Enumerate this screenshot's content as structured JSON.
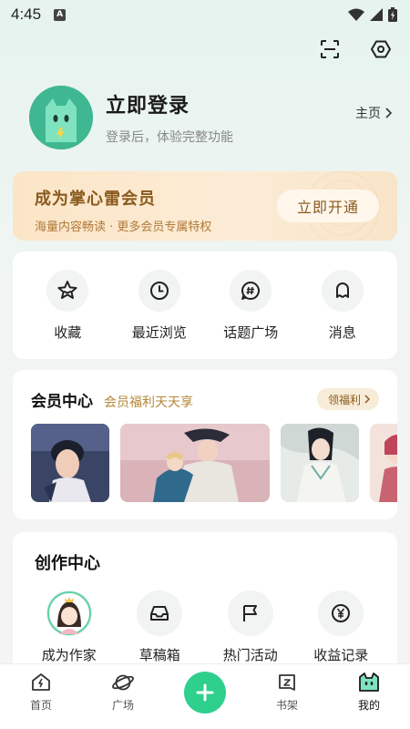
{
  "status": {
    "time": "4:45",
    "notif": "A"
  },
  "profile": {
    "title": "立即登录",
    "subtitle": "登录后，体验完整功能",
    "home_link": "主页"
  },
  "vip": {
    "title": "成为掌心雷会员",
    "subtitle": "海量内容畅读 · 更多会员专属特权",
    "button": "立即开通"
  },
  "quick_actions": [
    {
      "label": "收藏",
      "icon": "star-icon"
    },
    {
      "label": "最近浏览",
      "icon": "clock-icon"
    },
    {
      "label": "话题广场",
      "icon": "hashtag-icon"
    },
    {
      "label": "消息",
      "icon": "bell-icon"
    }
  ],
  "member_center": {
    "title": "会员中心",
    "subtitle": "会员福利天天享",
    "welfare_button": "领福利"
  },
  "creation": {
    "title": "创作中心",
    "items": [
      {
        "label": "成为作家",
        "icon": "author-avatar"
      },
      {
        "label": "草稿箱",
        "icon": "inbox-icon"
      },
      {
        "label": "热门活动",
        "icon": "flag-icon"
      },
      {
        "label": "收益记录",
        "icon": "yen-icon"
      }
    ]
  },
  "tabbar": [
    {
      "label": "首页",
      "icon": "home-lightning-icon"
    },
    {
      "label": "广场",
      "icon": "planet-icon"
    },
    {
      "label": "",
      "icon": "plus-icon"
    },
    {
      "label": "书架",
      "icon": "bookshelf-icon"
    },
    {
      "label": "我的",
      "icon": "cat-face-icon"
    }
  ],
  "colors": {
    "accent": "#2fcf8d",
    "vip_text": "#8a5a1e",
    "avatar_bg": "#3fb791"
  }
}
